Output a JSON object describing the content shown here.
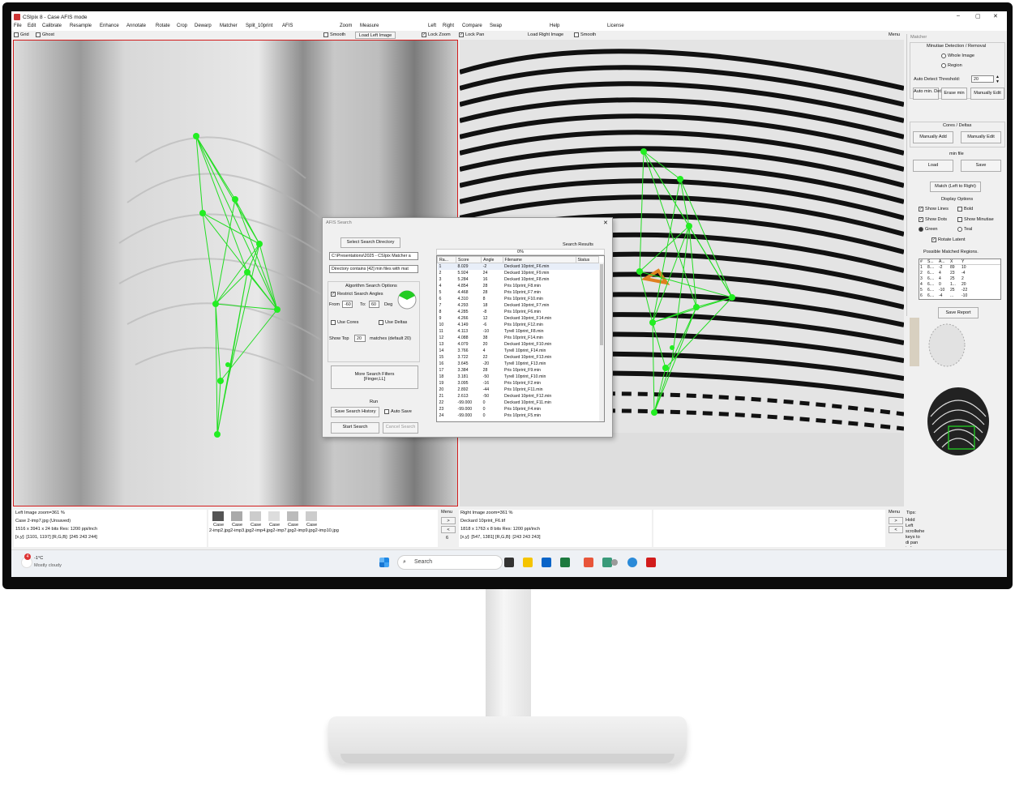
{
  "window": {
    "title": "CSIpix 8 - Case AFIS mode",
    "min": "–",
    "max": "▢",
    "close": "✕"
  },
  "menu": [
    "File",
    "Edit",
    "Calibrate",
    "Resample",
    "Enhance",
    "Annotate",
    "Rotate",
    "Crop",
    "Dewarp",
    "Matcher",
    "Split_10print",
    "AFIS",
    "Zoom",
    "Measure",
    "Left",
    "Right",
    "Compare",
    "Swap",
    "Help",
    "License"
  ],
  "toolbar": {
    "grid": "Grid",
    "ghost": "Ghost",
    "smooth_left": "Smooth",
    "load_left": "Load Left Image",
    "lock_zoom": "Lock Zoom",
    "lock_pan": "Lock Pan",
    "load_right": "Load Right Image",
    "smooth_right": "Smooth",
    "menu": "Menu"
  },
  "matcher": {
    "title": "Matcher",
    "minutiae_header": "Minutiae Detection / Removal",
    "whole_image": "Whole Image",
    "region": "Region",
    "threshold_label": "Auto Detect Threshold:",
    "threshold_value": "20",
    "auto_min_detect": "Auto min. Detect",
    "erase_min": "Erase min",
    "manually_edit": "Manually Edit",
    "cores_header": "Cores / Deltas",
    "manually_add": "Manually Add",
    "manually_edit2": "Manually Edit",
    "min_file": "min file",
    "load": "Load",
    "save": "Save",
    "match_btn": "Match (Left to Right)",
    "display_options": "Display Options",
    "show_lines": "Show Lines",
    "bold": "Bold",
    "show_dots": "Show Dots",
    "show_minutiae": "Show Minutiae",
    "green": "Green",
    "teal": "Teal",
    "rotate_latent": "Rotate Latent",
    "possible_regions": "Possible Matched Regions.",
    "regions_headers": [
      "#",
      "S...",
      "A...",
      "X",
      "Y"
    ],
    "regions_rows": [
      [
        "1",
        "8....",
        "-2",
        "89",
        "10"
      ],
      [
        "2",
        "6....",
        "4",
        "23",
        "-4"
      ],
      [
        "3",
        "6....",
        "4",
        "25",
        "2"
      ],
      [
        "4",
        "6....",
        "0",
        "1...",
        "20"
      ],
      [
        "5",
        "6....",
        "-10",
        "25",
        "-22"
      ],
      [
        "6",
        "6....",
        "-4",
        "...",
        "-10"
      ]
    ],
    "save_report": "Save Report"
  },
  "afis": {
    "title": "AFIS Search",
    "select_dir": "Select Search Directory",
    "dir_path": "C:\\Presentations\\2025 - CSIpix Matcher a",
    "dir_info": "Directory contains [42] min files with mat",
    "algo_header": "Algorithm Search Options",
    "restrict_angles": "Restrict Search Angles",
    "from_label": "From",
    "from_value": "-60",
    "to_label": "To:",
    "to_value": "60",
    "deg": "Deg",
    "use_cores": "Use Cores",
    "use_deltas": "Use Deltas",
    "show_top_label": "Show Top",
    "show_top_value": "20",
    "matches_note": "matches (default 20)",
    "more_filters": "More Search Filters\n[Finger,LL]",
    "run_header": "Run",
    "save_history": "Save Search History",
    "auto_save": "Auto Save",
    "start_search": "Start Search",
    "cancel_search": "Cancel Search",
    "results_header": "Search Results",
    "progress": "0%",
    "columns": [
      "Ra...",
      "Score",
      "Angle",
      "Filename",
      "Status"
    ],
    "rows": [
      [
        "1",
        "8.029",
        "-2",
        "Deckard 10print_F6.min",
        ""
      ],
      [
        "2",
        "5.924",
        "24",
        "Deckard 10print_F9.min",
        ""
      ],
      [
        "3",
        "5.284",
        "16",
        "Deckard 10print_F8.min",
        ""
      ],
      [
        "4",
        "4.854",
        "28",
        "Pris 10print_F8.min",
        ""
      ],
      [
        "5",
        "4.468",
        "28",
        "Pris 10print_F7.min",
        ""
      ],
      [
        "6",
        "4.310",
        "8",
        "Pris 10print_F10.min",
        ""
      ],
      [
        "7",
        "4.293",
        "18",
        "Deckard 10print_F7.min",
        ""
      ],
      [
        "8",
        "4.285",
        "-8",
        "Pris 10print_F6.min",
        ""
      ],
      [
        "9",
        "4.266",
        "12",
        "Deckard 10print_F14.min",
        ""
      ],
      [
        "10",
        "4.149",
        "-6",
        "Pris 10print_F12.min",
        ""
      ],
      [
        "11",
        "4.113",
        "-10",
        "Tyrell 10print_F8.min",
        ""
      ],
      [
        "12",
        "4.088",
        "38",
        "Pris 10print_F14.min",
        ""
      ],
      [
        "13",
        "4.079",
        "20",
        "Deckard 10print_F10.min",
        ""
      ],
      [
        "14",
        "3.766",
        "4",
        "Tyrell 10print_F14.min",
        ""
      ],
      [
        "15",
        "3.722",
        "22",
        "Deckard 10print_F13.min",
        ""
      ],
      [
        "16",
        "3.645",
        "-20",
        "Tyrell 10print_F13.min",
        ""
      ],
      [
        "17",
        "3.384",
        "28",
        "Pris 10print_F9.min",
        ""
      ],
      [
        "18",
        "3.181",
        "-50",
        "Tyrell 10print_F10.min",
        ""
      ],
      [
        "19",
        "3.095",
        "-16",
        "Pris 10print_F2.min",
        ""
      ],
      [
        "20",
        "2.892",
        "-44",
        "Pris 10print_F11.min",
        ""
      ],
      [
        "21",
        "2.613",
        "-50",
        "Deckard 10print_F12.min",
        ""
      ],
      [
        "22",
        "-99.000",
        "0",
        "Deckard 10print_F11.min",
        ""
      ],
      [
        "23",
        "-99.000",
        "0",
        "Pris 10print_F4.min",
        ""
      ],
      [
        "24",
        "-99.000",
        "0",
        "Pris 10print_F5.min",
        ""
      ]
    ]
  },
  "left_info": {
    "line1": "Left Image   zoom=361 %",
    "line2": "Case 2-imp7.jpg  (Unsaved)",
    "line3": "1516 x 3941 x 24 bits    Res: 1200 ppi/inch",
    "line4": "[x,y]: [1101, 1197]    [R,G,B]: [245 243 244]"
  },
  "thumbs": {
    "labels": [
      "Case",
      "Case",
      "Case",
      "Case",
      "Case",
      "Case"
    ],
    "names": "2-imp2.jpg2-imp3.jpg2-imp4.jpg2-imp7.jpg2-imp9.jpg2-imp10.jpg"
  },
  "right_info": {
    "line1": "Right Image   zoom=361 %",
    "line2": "Deckard 10print_F6.tif",
    "line3": "1818 x 1763 x 8 bits    Res: 1200 ppi/inch",
    "line4": "[x,y]: [547, 1381]    [R,G,B]: [243 243 243]"
  },
  "bottom_nav": {
    "menu": "Menu",
    "gt": ">",
    "lt": "<",
    "page": "6"
  },
  "tips": {
    "title": "Tips:",
    "text": "Hold Left scrollwhe keys to di pan indep"
  },
  "taskbar": {
    "temp": "-1°C",
    "weather": "Mostly cloudy",
    "search": "Search"
  }
}
